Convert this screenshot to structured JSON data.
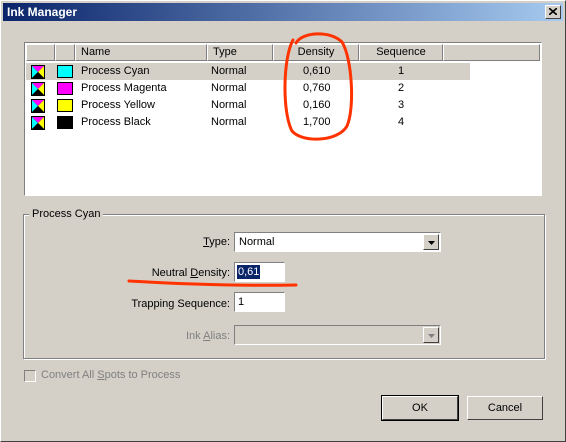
{
  "window": {
    "title": "Ink Manager"
  },
  "ink_table": {
    "columns": [
      "Name",
      "Type",
      "Density",
      "Sequence"
    ],
    "rows": [
      {
        "name": "Process Cyan",
        "type": "Normal",
        "density": "0,610",
        "sequence": "1",
        "color": "#00ffff",
        "selected": true
      },
      {
        "name": "Process Magenta",
        "type": "Normal",
        "density": "0,760",
        "sequence": "2",
        "color": "#ff00ff",
        "selected": false
      },
      {
        "name": "Process Yellow",
        "type": "Normal",
        "density": "0,160",
        "sequence": "3",
        "color": "#ffff00",
        "selected": false
      },
      {
        "name": "Process Black",
        "type": "Normal",
        "density": "1,700",
        "sequence": "4",
        "color": "#000000",
        "selected": false
      }
    ]
  },
  "details": {
    "group_title": "Process Cyan",
    "type_label_pre": "",
    "type_label_mn": "T",
    "type_label_post": "ype:",
    "type_value": "Normal",
    "neutral_label_pre": "Neutral ",
    "neutral_label_mn": "D",
    "neutral_label_post": "ensity:",
    "neutral_value": "0,61",
    "trapping_label": "Trapping Sequence:",
    "trapping_value": "1",
    "alias_label_pre": "Ink ",
    "alias_label_mn": "A",
    "alias_label_post": "lias:",
    "alias_value": ""
  },
  "convert": {
    "label_pre": "Convert All ",
    "label_mn": "S",
    "label_post": "pots to Process",
    "checked": false,
    "enabled": false
  },
  "buttons": {
    "ok": "OK",
    "cancel": "Cancel"
  },
  "annotation_color": "#ff3300"
}
